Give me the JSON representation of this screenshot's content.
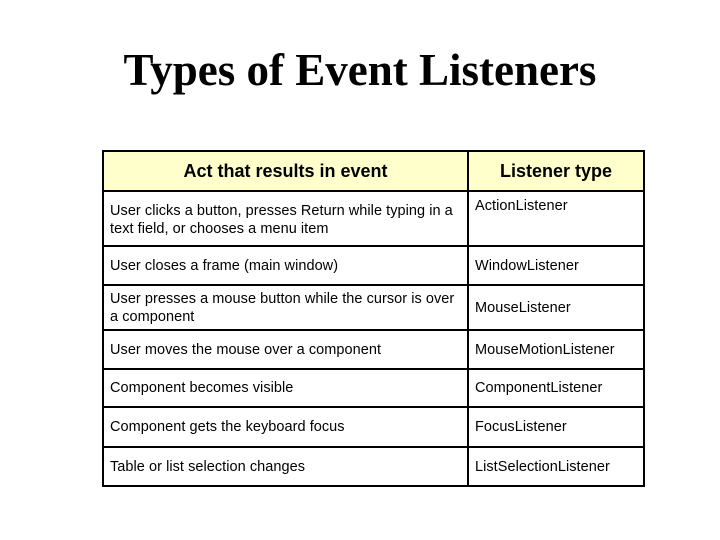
{
  "title": "Types of Event Listeners",
  "table": {
    "headers": {
      "act": "Act that results in event",
      "listener": "Listener type"
    },
    "header_background": "#ffffcc",
    "rows": [
      {
        "act": "User clicks a button, presses Return while typing in a text field, or chooses a menu item",
        "listener": "ActionListener"
      },
      {
        "act": "User closes a frame (main window)",
        "listener": "WindowListener"
      },
      {
        "act": "User presses a mouse button while the cursor is over a component",
        "listener": "MouseListener"
      },
      {
        "act": "User moves the mouse over a component",
        "listener": "MouseMotionListener"
      },
      {
        "act": "Component becomes visible",
        "listener": "ComponentListener"
      },
      {
        "act": "Component gets the keyboard focus",
        "listener": "FocusListener"
      },
      {
        "act": "Table or list selection changes",
        "listener": "ListSelectionListener"
      }
    ]
  }
}
